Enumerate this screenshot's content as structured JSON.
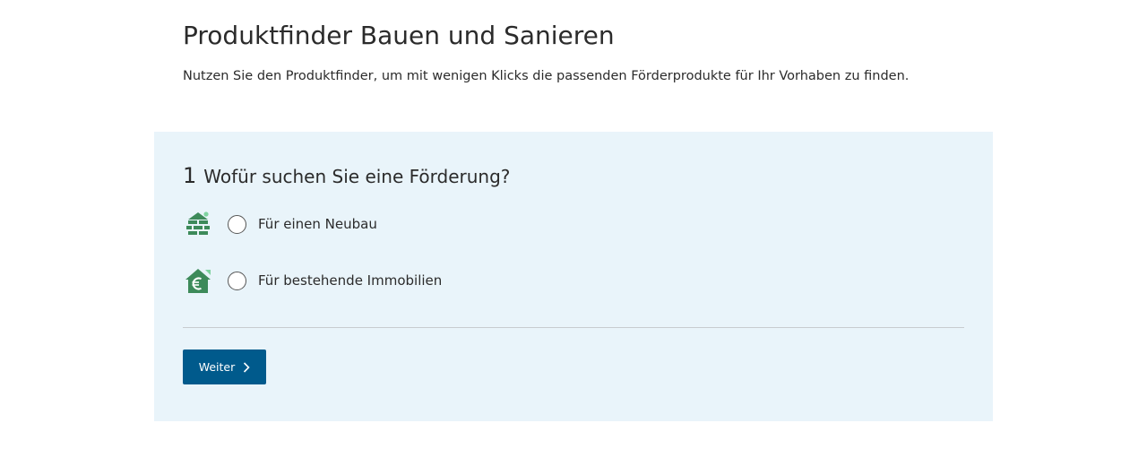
{
  "header": {
    "title": "Produktfinder Bauen und Sanieren",
    "intro": "Nutzen Sie den Produktfinder, um mit wenigen Klicks die passenden Förderprodukte für Ihr Vorhaben zu finden."
  },
  "question": {
    "step": "1",
    "text": "Wofür suchen Sie eine Förderung?"
  },
  "options": [
    {
      "label": "Für einen Neubau",
      "icon": "brick-house-icon",
      "selected": false
    },
    {
      "label": "Für bestehende Immobilien",
      "icon": "euro-house-icon",
      "selected": false
    }
  ],
  "actions": {
    "next_label": "Weiter",
    "next_icon": "chevron-right-icon"
  },
  "colors": {
    "panel_background": "#e9f4fa",
    "button_background": "#005a8c",
    "icon_green": "#3d8a5a",
    "icon_accent": "#7fd3a0"
  }
}
